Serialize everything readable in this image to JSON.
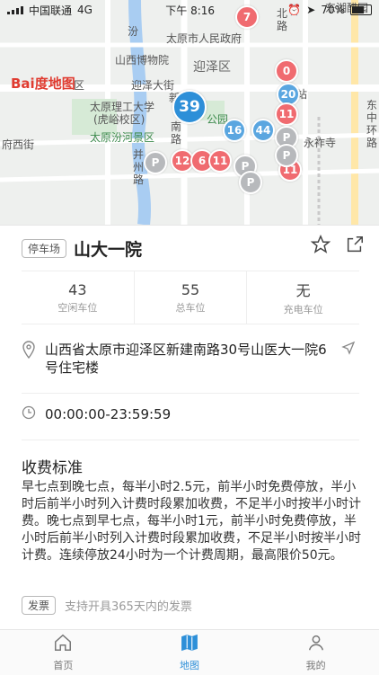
{
  "statusbar": {
    "carrier": "中国联通",
    "network": "4G",
    "time": "下午 8:16",
    "battery": "70%",
    "battery_level": 0.7
  },
  "map": {
    "labels": {
      "govt": "太原市人民政府",
      "museum": "山西博物院",
      "district": "迎泽区",
      "yingze_st": "迎泽大街",
      "univ": "太原理工大学",
      "univ2": "(虎峪校区)",
      "scenic": "太原汾河景区",
      "park": "公园",
      "yongzuo": "永祚寺",
      "east_road": "东中环路",
      "north_road": "北路",
      "bing_road": "并州路",
      "fen_river": "汾",
      "station": "站",
      "west_st": "府西街",
      "nanlu": "南路",
      "xinjian": "新建",
      "dong": "东湖醋园",
      "qu": "区",
      "baidu": "Bai度地图"
    },
    "markers": [
      "7",
      "0",
      "20",
      "11",
      "39",
      "16",
      "44",
      "11",
      "12",
      "6",
      "11"
    ]
  },
  "lot": {
    "tag": "停车场",
    "name": "山大一院",
    "stats": [
      {
        "value": "43",
        "label": "空闲车位"
      },
      {
        "value": "55",
        "label": "总车位"
      },
      {
        "value": "无",
        "label": "充电车位"
      }
    ],
    "address": "山西省太原市迎泽区新建南路30号山医大一院6号住宅楼",
    "hours": "00:00:00-23:59:59",
    "fee_title": "收费标准",
    "fee_text": "早七点到晚七点，每半小时2.5元，前半小时免费停放，半小时后前半小时列入计费时段累加收费，不足半小时按半小时计费。晚七点到早七点，每半小时1元，前半小时免费停放，半小时后前半小时列入计费时段累加收费，不足半小时按半小时计费。连续停放24小时为一个计费周期，最高限价50元。",
    "invoice_tag": "发票",
    "invoice_note": "支持开具365天内的发票"
  },
  "tabs": [
    {
      "label": "首页",
      "icon": "home-icon"
    },
    {
      "label": "地图",
      "icon": "map-icon"
    },
    {
      "label": "我的",
      "icon": "user-icon"
    }
  ]
}
